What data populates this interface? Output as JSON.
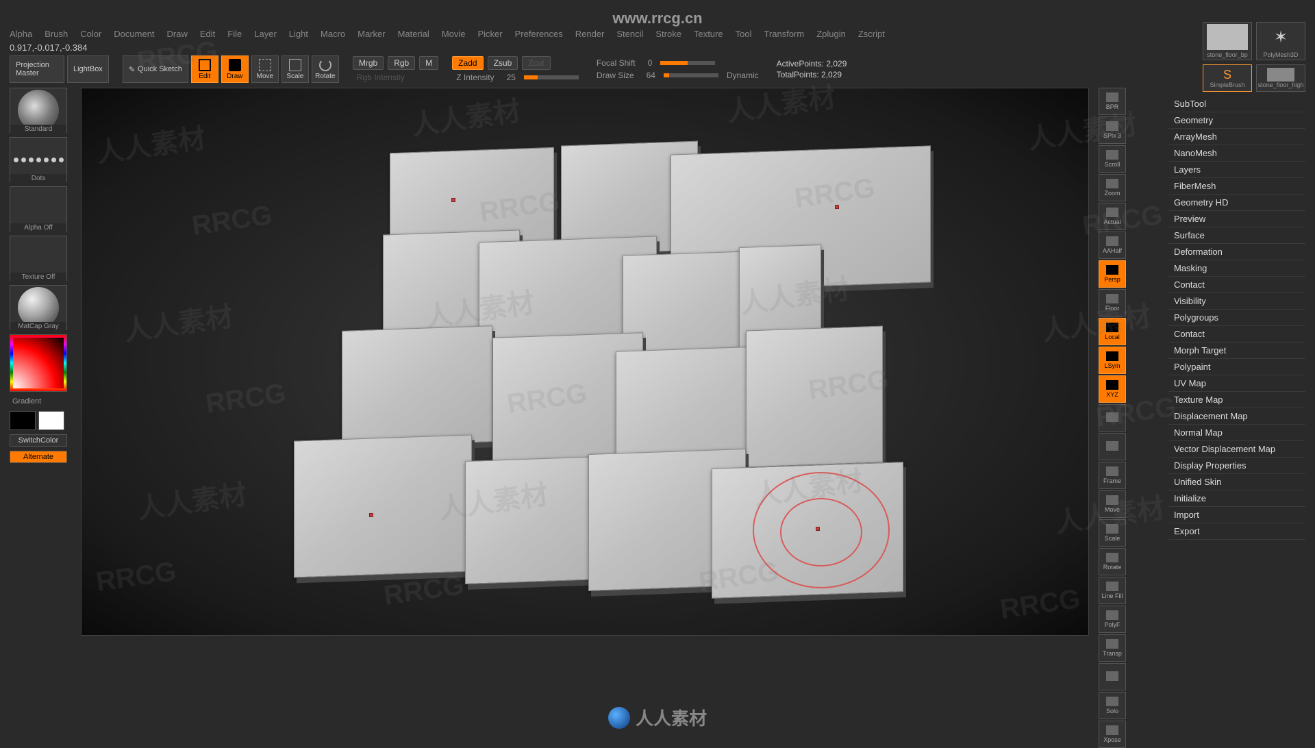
{
  "url_overlay": "www.rrcg.cn",
  "menu": [
    "Alpha",
    "Brush",
    "Color",
    "Document",
    "Draw",
    "Edit",
    "File",
    "Layer",
    "Light",
    "Macro",
    "Marker",
    "Material",
    "Movie",
    "Picker",
    "Preferences",
    "Render",
    "Stencil",
    "Stroke",
    "Texture",
    "Tool",
    "Transform",
    "Zplugin",
    "Zscript"
  ],
  "coords": "0.917,-0.017,-0.384",
  "toolbar": {
    "projection_master": "Projection Master",
    "lightbox": "LightBox",
    "quick_sketch": "Quick Sketch",
    "edit": "Edit",
    "draw": "Draw",
    "move": "Move",
    "scale": "Scale",
    "rotate": "Rotate",
    "mrgb": "Mrgb",
    "rgb": "Rgb",
    "m": "M",
    "rgb_intensity_label": "Rgb Intensity",
    "zadd": "Zadd",
    "zsub": "Zsub",
    "zcut": "Zcut",
    "z_intensity_label": "Z Intensity",
    "z_intensity_value": "25",
    "focal_shift_label": "Focal Shift",
    "focal_shift_value": "0",
    "draw_size_label": "Draw Size",
    "draw_size_value": "64",
    "dynamic": "Dynamic",
    "active_points_label": "ActivePoints:",
    "active_points_value": "2,029",
    "total_points_label": "TotalPoints:",
    "total_points_value": "2,029"
  },
  "left": {
    "brush_name": "Standard",
    "stroke_name": "Dots",
    "alpha_label": "Alpha Off",
    "texture_label": "Texture Off",
    "material_label": "MatCap Gray",
    "gradient": "Gradient",
    "switch_color": "SwitchColor",
    "alternate": "Alternate"
  },
  "right_toolbar": [
    {
      "label": "BPR",
      "active": false
    },
    {
      "label": "SPix 3",
      "active": false
    },
    {
      "label": "Scroll",
      "active": false
    },
    {
      "label": "Zoom",
      "active": false
    },
    {
      "label": "Actual",
      "active": false
    },
    {
      "label": "AAHalf",
      "active": false
    },
    {
      "label": "Persp",
      "active": true
    },
    {
      "label": "Floor",
      "active": false
    },
    {
      "label": "Local",
      "active": true
    },
    {
      "label": "LSym",
      "active": true
    },
    {
      "label": "XYZ",
      "active": true
    },
    {
      "label": "",
      "active": false
    },
    {
      "label": "",
      "active": false
    },
    {
      "label": "Frame",
      "active": false
    },
    {
      "label": "Move",
      "active": false
    },
    {
      "label": "Scale",
      "active": false
    },
    {
      "label": "Rotate",
      "active": false
    },
    {
      "label": "Line Fill",
      "active": false
    },
    {
      "label": "PolyF",
      "active": false
    },
    {
      "label": "Transp",
      "active": false
    },
    {
      "label": "",
      "active": false
    },
    {
      "label": "Solo",
      "active": false
    },
    {
      "label": "Xpose",
      "active": false
    }
  ],
  "thumbs": {
    "t1_label": "stone_floor_bp",
    "t2_label": "PolyMesh3D",
    "b1_label": "SimpleBrush",
    "b2_label": "stone_floor_high"
  },
  "tool_panel": [
    "SubTool",
    "Geometry",
    "ArrayMesh",
    "NanoMesh",
    "Layers",
    "FiberMesh",
    "Geometry HD",
    "Preview",
    "Surface",
    "Deformation",
    "Masking",
    "Contact",
    "Visibility",
    "Polygroups",
    "Contact",
    "Morph Target",
    "Polypaint",
    "UV Map",
    "Texture Map",
    "Displacement Map",
    "Normal Map",
    "Vector Displacement Map",
    "Display Properties",
    "Unified Skin",
    "Initialize",
    "Import",
    "Export"
  ],
  "watermark_text": "人人素材",
  "watermark_text2": "RRCG",
  "bottom_badge": "人人素材"
}
